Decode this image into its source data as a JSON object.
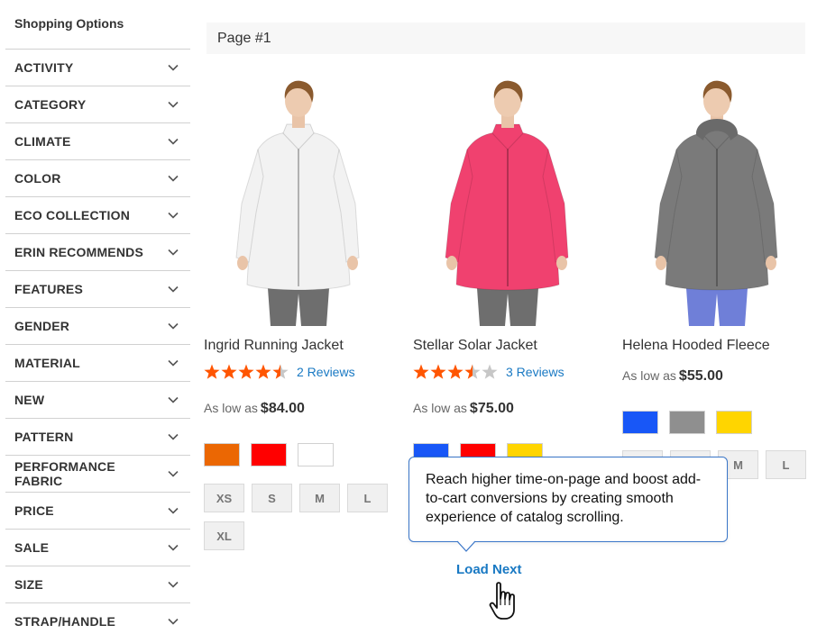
{
  "sidebar": {
    "title": "Shopping Options",
    "filters": [
      {
        "label": "ACTIVITY"
      },
      {
        "label": "CATEGORY"
      },
      {
        "label": "CLIMATE"
      },
      {
        "label": "COLOR"
      },
      {
        "label": "ECO COLLECTION"
      },
      {
        "label": "ERIN RECOMMENDS"
      },
      {
        "label": "FEATURES"
      },
      {
        "label": "GENDER"
      },
      {
        "label": "MATERIAL"
      },
      {
        "label": "NEW"
      },
      {
        "label": "PATTERN"
      },
      {
        "label": "PERFORMANCE FABRIC"
      },
      {
        "label": "PRICE"
      },
      {
        "label": "SALE"
      },
      {
        "label": "SIZE"
      },
      {
        "label": "STRAP/HANDLE"
      }
    ],
    "chevron_icon": "chevron-down-icon"
  },
  "page_header": {
    "label": "Page #1"
  },
  "products": [
    {
      "name": "Ingrid Running Jacket",
      "rating": 4.5,
      "reviews": "2 Reviews",
      "price_prefix": "As low as",
      "price": "$84.00",
      "jacket_color": "#f2f2f2",
      "swatches": [
        "#eb6703",
        "#ff0000",
        "#ffffff"
      ],
      "sizes": [
        "XS",
        "S",
        "M",
        "L",
        "XL"
      ]
    },
    {
      "name": "Stellar Solar Jacket",
      "rating": 3.5,
      "reviews": "3 Reviews",
      "price_prefix": "As low as",
      "price": "$75.00",
      "jacket_color": "#f0416f",
      "swatches": [
        "#1857f7",
        "#ff0000",
        "#ffd500"
      ],
      "sizes": []
    },
    {
      "name": "Helena Hooded Fleece",
      "rating": null,
      "reviews": "",
      "price_prefix": "As low as",
      "price": "$55.00",
      "jacket_color": "#7a7a7a",
      "swatches": [
        "#1857f7",
        "#8f8f8f",
        "#ffd500"
      ],
      "sizes": [
        "",
        "",
        "M",
        "L"
      ]
    }
  ],
  "colors": {
    "star_filled": "#ff5501",
    "star_empty": "#c7c7c7",
    "link": "#1979c3",
    "tooltip_border": "#3a76c8"
  },
  "tooltip": {
    "text": "Reach higher time-on-page and boost add-to-cart conversions by creating smooth experience of catalog scrolling."
  },
  "load_next": {
    "label": "Load Next"
  },
  "cursor_icon": "hand-pointer-icon"
}
